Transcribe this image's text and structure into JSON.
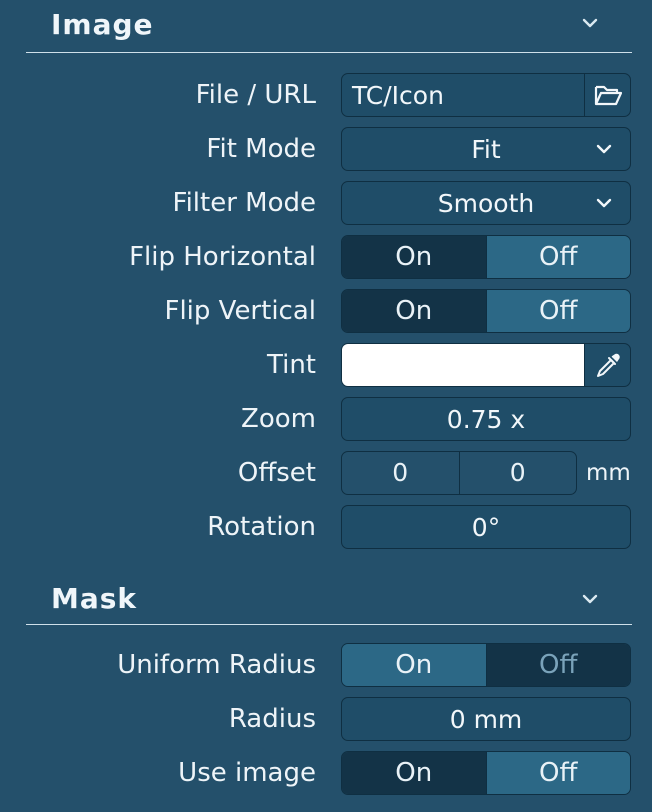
{
  "image_section": {
    "title": "Image",
    "rows": {
      "file_url": {
        "label": "File / URL",
        "value": "TC/Icon"
      },
      "fit_mode": {
        "label": "Fit Mode",
        "value": "Fit"
      },
      "filter_mode": {
        "label": "Filter Mode",
        "value": "Smooth"
      },
      "flip_horizontal": {
        "label": "Flip Horizontal",
        "on": "On",
        "off": "Off",
        "selected": "On"
      },
      "flip_vertical": {
        "label": "Flip Vertical",
        "on": "On",
        "off": "Off",
        "selected": "On"
      },
      "tint": {
        "label": "Tint",
        "color": "#ffffff"
      },
      "zoom": {
        "label": "Zoom",
        "value": "0.75 x"
      },
      "offset": {
        "label": "Offset",
        "x": "0",
        "y": "0",
        "unit": "mm"
      },
      "rotation": {
        "label": "Rotation",
        "value": "0°"
      }
    }
  },
  "mask_section": {
    "title": "Mask",
    "rows": {
      "uniform_radius": {
        "label": "Uniform Radius",
        "on": "On",
        "off": "Off",
        "selected": "Off"
      },
      "radius": {
        "label": "Radius",
        "value": "0 mm"
      },
      "use_image": {
        "label": "Use image",
        "on": "On",
        "off": "Off",
        "selected": "On"
      }
    }
  },
  "icons": {
    "section_collapse": "chevron-down-icon",
    "browse": "folder-open-icon",
    "eyedropper": "eyedropper-icon",
    "dropdown": "chevron-down-icon"
  },
  "colors": {
    "panel_bg": "#24506b",
    "field_bg": "#1f4d68",
    "segment_dark": "#133347",
    "segment_mid": "#2c6886",
    "border": "#0f2f42"
  }
}
